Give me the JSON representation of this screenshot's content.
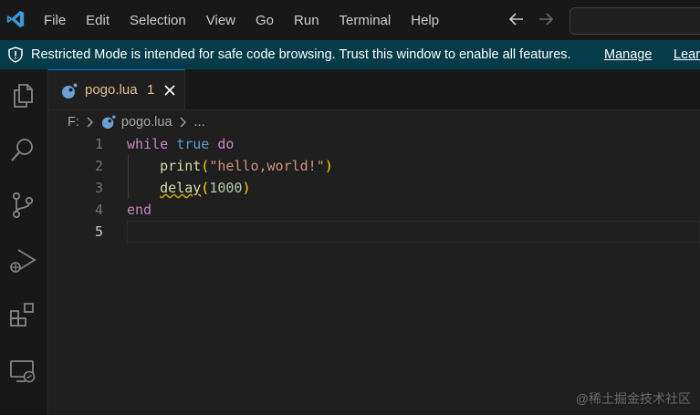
{
  "menu": {
    "items": [
      "File",
      "Edit",
      "Selection",
      "View",
      "Go",
      "Run",
      "Terminal",
      "Help"
    ]
  },
  "banner": {
    "text": "Restricted Mode is intended for safe code browsing. Trust this window to enable all features.",
    "manage": "Manage",
    "learn": "Lear"
  },
  "tab": {
    "name": "pogo.lua",
    "count": "1"
  },
  "breadcrumb": {
    "drive": "F:",
    "file": "pogo.lua",
    "more": "..."
  },
  "editor": {
    "lines": [
      {
        "num": "1",
        "tokens": [
          [
            "kw",
            "while"
          ],
          [
            "sp",
            " "
          ],
          [
            "kw-bool",
            "true"
          ],
          [
            "sp",
            " "
          ],
          [
            "kw",
            "do"
          ]
        ]
      },
      {
        "num": "2",
        "tokens": [
          [
            "sp",
            "    "
          ],
          [
            "fn",
            "print"
          ],
          [
            "paren",
            "("
          ],
          [
            "str",
            "\"hello,world!\""
          ],
          [
            "paren",
            ")"
          ]
        ]
      },
      {
        "num": "3",
        "tokens": [
          [
            "sp",
            "    "
          ],
          [
            "fn squiggle",
            "delay"
          ],
          [
            "paren",
            "("
          ],
          [
            "num",
            "1000"
          ],
          [
            "paren",
            ")"
          ]
        ]
      },
      {
        "num": "4",
        "tokens": [
          [
            "kw",
            "end"
          ]
        ]
      },
      {
        "num": "5",
        "tokens": []
      }
    ],
    "active_line": 5
  },
  "watermark": "@稀土掘金技术社区",
  "colors": {
    "accent": "#0078d4",
    "banner_bg": "#063b49",
    "tab_text": "#e2c08d"
  },
  "icons": [
    "vscode-logo",
    "arrow-left-icon",
    "arrow-right-icon",
    "shield-icon",
    "files-icon",
    "search-icon",
    "source-control-icon",
    "run-debug-icon",
    "extensions-icon",
    "remote-explorer-icon",
    "lua-file-icon",
    "close-icon",
    "chevron-right-icon"
  ]
}
